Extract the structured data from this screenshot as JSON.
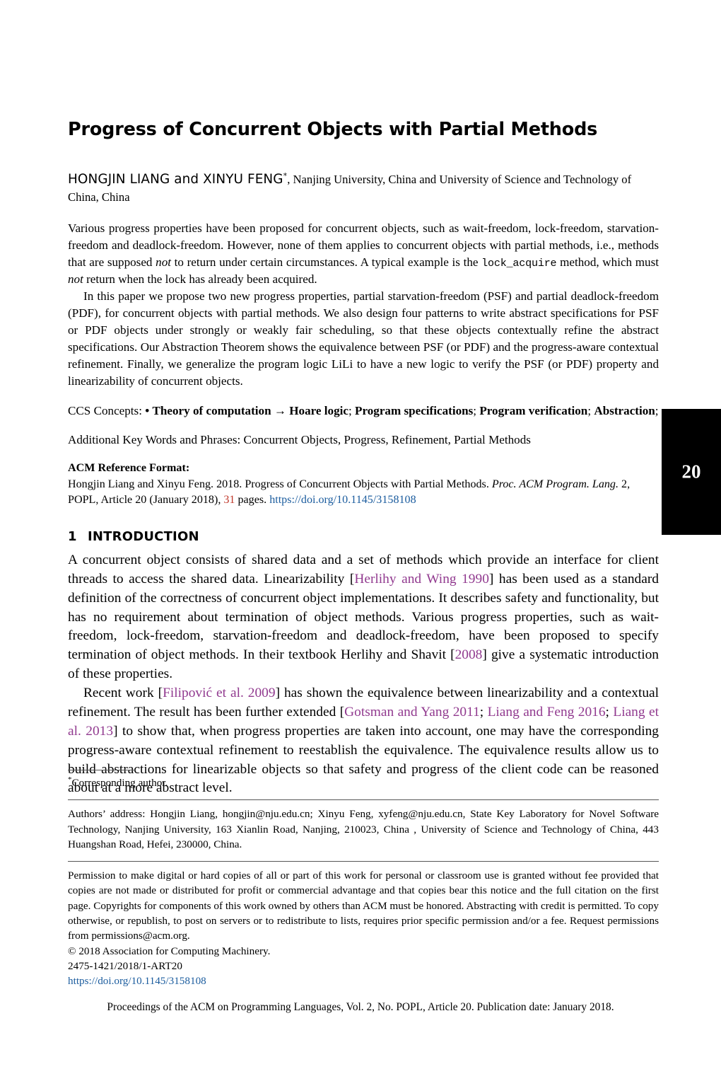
{
  "paper": {
    "title": "Progress of Concurrent Objects with Partial Methods",
    "authors": {
      "names": "HONGJIN LIANG and XINYU FENG",
      "corresponding_marker": "*",
      "affiliation": ", Nanjing University, China and University of Science and Technology of China, China"
    },
    "abstract": {
      "para1_a": "Various progress properties have been proposed for concurrent objects, such as wait-freedom, lock-freedom, starvation-freedom and deadlock-freedom. However, none of them applies to concurrent objects with partial methods, i.e., methods that are supposed ",
      "para1_not1": "not",
      "para1_b": " to return under certain circumstances. A typical example is the ",
      "para1_code": "lock_acquire",
      "para1_c": " method, which must ",
      "para1_not2": "not",
      "para1_d": " return when the lock has already been acquired.",
      "para2": "In this paper we propose two new progress properties, partial starvation-freedom (PSF) and partial deadlock-freedom (PDF), for concurrent objects with partial methods. We also design four patterns to write abstract specifications for PSF or PDF objects under strongly or weakly fair scheduling, so that these objects contextually refine the abstract specifications. Our Abstraction Theorem shows the equivalence between PSF (or PDF) and the progress-aware contextual refinement. Finally, we generalize the program logic LiLi to have a new logic to verify the PSF (or PDF) property and linearizability of concurrent objects."
    },
    "ccs": {
      "label": "CCS Concepts:",
      "bullet": "•",
      "category": "Theory of computation",
      "arrow": "→",
      "concepts": [
        "Hoare logic",
        "Program specifications",
        "Program verification",
        "Abstraction"
      ],
      "separator": "; ",
      "terminator": ";"
    },
    "keywords": {
      "label": "Additional Key Words and Phrases:",
      "value": "Concurrent Objects, Progress, Refinement, Partial Methods"
    },
    "reference_format": {
      "heading": "ACM Reference Format:",
      "text_a": "Hongjin Liang and Xinyu Feng. 2018. Progress of Concurrent Objects with Partial Methods. ",
      "journal_italic": "Proc. ACM Program. Lang.",
      "text_b": " 2, POPL, Article 20 (January 2018), ",
      "pages": "31",
      "text_c": " pages. ",
      "doi": "https://doi.org/10.1145/3158108"
    },
    "article_badge": {
      "number": "20"
    },
    "section": {
      "number": "1",
      "title": "INTRODUCTION"
    },
    "intro": {
      "p1_a": "A concurrent object consists of shared data and a set of methods which provide an interface for client threads to access the shared data. Linearizability [",
      "p1_cite1": "Herlihy and Wing 1990",
      "p1_b": "] has been used as a standard definition of the correctness of concurrent object implementations. It describes safety and functionality, but has no requirement about termination of object methods. Various progress properties, such as wait-freedom, lock-freedom, starvation-freedom and deadlock-freedom, have been proposed to specify termination of object methods. In their textbook Herlihy and Shavit [",
      "p1_cite2": "2008",
      "p1_c": "] give a systematic introduction of these properties.",
      "p2_a": "Recent work [",
      "p2_cite1": "Filipović et al. 2009",
      "p2_b": "] has shown the equivalence between linearizability and a contextual refinement. The result has been further extended [",
      "p2_cite2": "Gotsman and Yang 2011",
      "p2_sep1": "; ",
      "p2_cite3": "Liang and Feng 2016",
      "p2_sep2": "; ",
      "p2_cite4": "Liang et al. 2013",
      "p2_c": "] to show that, when progress properties are taken into account, one may have the corresponding progress-aware contextual refinement to reestablish the equivalence. The equivalence results allow us to build abstractions for linearizable objects so that safety and progress of the client code can be reasoned about at a more abstract level."
    },
    "footnotes": {
      "corresponding_marker": "*",
      "corresponding": "Corresponding author.",
      "authors_address": "Authors’ address: Hongjin Liang, hongjin@nju.edu.cn; Xinyu Feng, xyfeng@nju.edu.cn, State Key Laboratory for Novel Software Technology, Nanjing University, 163 Xianlin Road, Nanjing, 210023, China , University of Science and Technology of China, 443 Huangshan Road, Hefei, 230000, China.",
      "permission": "Permission to make digital or hard copies of all or part of this work for personal or classroom use is granted without fee provided that copies are not made or distributed for profit or commercial advantage and that copies bear this notice and the full citation on the first page. Copyrights for components of this work owned by others than ACM must be honored. Abstracting with credit is permitted. To copy otherwise, or republish, to post on servers or to redistribute to lists, requires prior specific permission and/or a fee. Request permissions from permissions@acm.org.",
      "copyright": "© 2018 Association for Computing Machinery.",
      "issn": "2475-1421/2018/1-ART20",
      "doi": "https://doi.org/10.1145/3158108"
    },
    "page_footer": "Proceedings of the ACM on Programming Languages, Vol. 2, No. POPL, Article 20. Publication date: January 2018."
  },
  "colors": {
    "citation": "#913a8f",
    "link": "#1b5c9e",
    "pages_highlight": "#c0392b",
    "badge_background": "#000000"
  }
}
